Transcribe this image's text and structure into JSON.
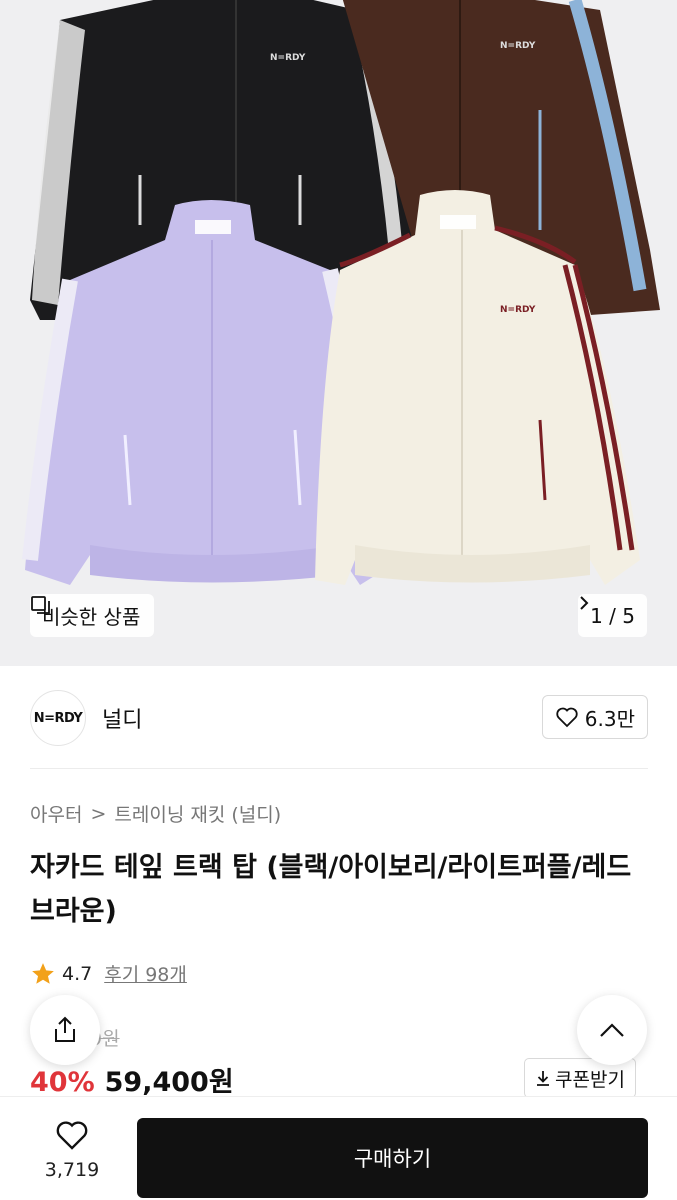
{
  "hero": {
    "similar_label": "비슷한 상품",
    "pager": "1 / 5",
    "jacket_logo": "N=RDY",
    "colors": {
      "black": "#1b1b1d",
      "brown": "#4a2a1f",
      "lavender": "#c7bfec",
      "ivory": "#f3efe3",
      "stripe_blue": "#8db3d8",
      "stripe_red": "#7a1f24"
    }
  },
  "brand": {
    "logo_text": "N=RDY",
    "name": "널디",
    "likes": "6.3만"
  },
  "breadcrumb": {
    "category": "아우터",
    "separator": ">",
    "subcategory": "트레이닝 재킷 (널디)"
  },
  "product": {
    "title": "자카드 테잎 트랙 탑 (블랙/아이보리/라이트퍼플/레드브라운)",
    "rating": "4.7",
    "reviews": "후기 98개",
    "original_price": "9원",
    "discount": "40%",
    "price": "59,400원",
    "coupon_label": "쿠폰받기"
  },
  "bottom_bar": {
    "wish_count": "3,719",
    "buy_label": "구매하기"
  },
  "colors": {
    "accent_red": "#e0353a",
    "star": "#f2a11a",
    "buy_bg": "#111111"
  }
}
